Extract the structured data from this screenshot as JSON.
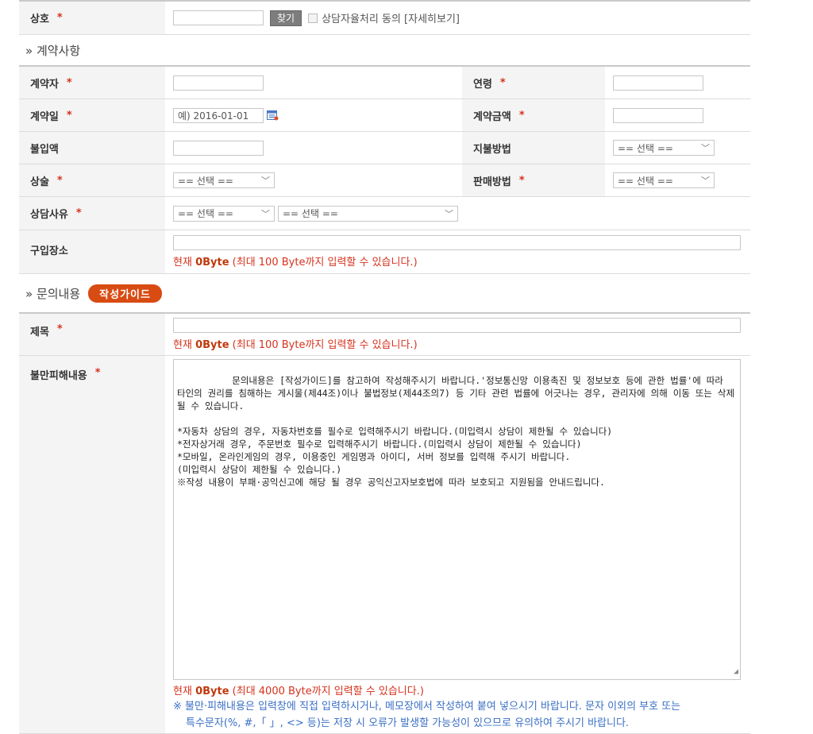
{
  "shop": {
    "label": "상호",
    "required": "*",
    "find_button": "찾기",
    "consent_label": "상담자율처리 동의 [자세히보기]"
  },
  "contract_section": {
    "title": "» 계약사항",
    "contractor": {
      "label": "계약자",
      "required": "*"
    },
    "age": {
      "label": "연령",
      "required": "*"
    },
    "contract_date": {
      "label": "계약일",
      "required": "*",
      "placeholder": "예) 2016-01-01"
    },
    "amount": {
      "label": "계약금액",
      "required": "*"
    },
    "unpaid": {
      "label": "불입액"
    },
    "payment_method": {
      "label": "지불방법",
      "selected": "== 선택 =="
    },
    "product": {
      "label": "상술",
      "required": "*",
      "selected": "== 선택 =="
    },
    "sales_method": {
      "label": "판매방법",
      "required": "*",
      "selected": "== 선택 =="
    },
    "reason": {
      "label": "상담사유",
      "required": "*",
      "selected1": "== 선택 ==",
      "selected2": "== 선택 =="
    },
    "place": {
      "label": "구입장소",
      "counter_prefix": "현재 ",
      "counter_value": "0Byte",
      "counter_suffix": " (최대 100 Byte까지 입력할 수 있습니다.)"
    }
  },
  "inquiry_section": {
    "title": "» 문의내용",
    "guide_button": "작성가이드",
    "subject": {
      "label": "제목",
      "required": "*",
      "counter_prefix": "현재 ",
      "counter_value": "0Byte",
      "counter_suffix": " (최대 100 Byte까지 입력할 수 있습니다.)"
    },
    "complaint": {
      "label": "불만피해내용",
      "required": "*",
      "text": "문의내용은 [작성가이드]를 참고하여 작성해주시기 바랍니다.'정보통신망 이용촉진 및 정보보호 등에 관한 법률'에 따라 타인의 권리를 침해하는 게시물(제44조)이나 불법정보(제44조의7) 등 기타 관련 법률에 어긋나는 경우, 관리자에 의해 이동 또는 삭제될 수 있습니다.\n\n*자동차 상담의 경우, 자동차번호를 필수로 입력해주시기 바랍니다.(미입력시 상담이 제한될 수 있습니다)\n*전자상거래 경우, 주문번호 필수로 입력해주시기 바랍니다.(미입력시 상담이 제한될 수 있습니다)\n*모바일, 온라인게임의 경우, 이용중인 게임명과 아이디, 서버 정보를 입력해 주시기 바랍니다.\n(미입력시 상담이 제한될 수 있습니다.)\n※작성 내용이 부패·공익신고에 해당 될 경우 공익신고자보호법에 따라 보호되고 지원됨을 안내드립니다.",
      "counter_prefix": "현재 ",
      "counter_value": "0Byte",
      "counter_suffix": " (최대 4000 Byte까지 입력할 수 있습니다.)",
      "notice_line1": "※ 불만·피해내용은 입력창에 직접 입력하시거나, 메모장에서 작성하여 붙여 넣으시기 바랍니다. 문자 이외의 부호 또는",
      "notice_line2": "특수문자(%, #,「 」, <> 등)는 저장 시 오류가 발생할 가능성이 있으므로 유의하여 주시기 바랍니다."
    }
  }
}
